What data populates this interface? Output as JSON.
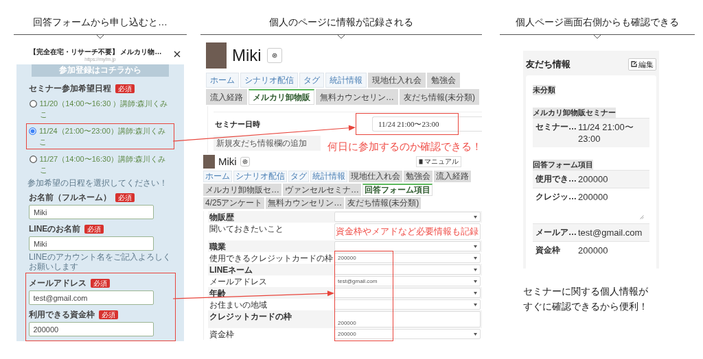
{
  "headings": [
    "回答フォームから申し込むと…",
    "個人のページに情報が記録される",
    "個人ページ画面右側からも確認できる"
  ],
  "form_panel": {
    "title": "【完全在宅・リサーチ不要】 メルカリ物…",
    "url": "https://myfm.jp",
    "banner": "参加登録はコチラから",
    "date_field": {
      "label": "セミナー参加希望日程",
      "badge": "必須",
      "hint": "参加希望の日程を選択してください！",
      "options": [
        {
          "text": "11/20（14:00〜16:30 ）講師:森川くみこ",
          "selected": false
        },
        {
          "text": "11/24（21:00〜23:00）講師:森川くみこ",
          "selected": true
        },
        {
          "text": "11/27（14:00〜16:30）講師:森川くみこ",
          "selected": false
        }
      ]
    },
    "fields": [
      {
        "label": "お名前（フルネーム）",
        "badge": "必須",
        "value": "Miki"
      },
      {
        "label": "LINEのお名前",
        "badge": "必須",
        "value": "Miki",
        "hint": "LINEのアカウント名をご記入よろしくお願いします"
      },
      {
        "label": "メールアドレス",
        "badge": "必須",
        "value": "test@gmail.com"
      },
      {
        "label": "利用できる資金枠",
        "badge": "必須",
        "value": "200000"
      }
    ]
  },
  "profile_top": {
    "name": "Miki",
    "tabs": [
      {
        "label": "ホーム",
        "kind": "main",
        "selected": false
      },
      {
        "label": "シナリオ配信",
        "kind": "main",
        "selected": false
      },
      {
        "label": "タグ",
        "kind": "main",
        "selected": false
      },
      {
        "label": "統計情報",
        "kind": "main",
        "selected": false
      },
      {
        "label": "現地仕入れ会",
        "kind": "custom",
        "selected": false
      },
      {
        "label": "勉強会",
        "kind": "custom",
        "selected": false
      },
      {
        "label": "流入経路",
        "kind": "custom",
        "selected": false
      },
      {
        "label": "メルカリ卸物販",
        "kind": "custom",
        "selected": true
      },
      {
        "label": "無料カウンセリン…",
        "kind": "custom",
        "selected": false
      },
      {
        "label": "友だち情報(未分類)",
        "kind": "custom",
        "selected": false
      }
    ],
    "rows": [
      {
        "label": "セミナー日時",
        "value": "11/24 21:00〜23:00"
      }
    ],
    "add_link": "新規友だち情報欄の追加",
    "annotation": "何日に参加するのか確認できる！"
  },
  "profile_bottom": {
    "name": "Miki",
    "manual_button": "マニュアル",
    "tabs": [
      {
        "label": "ホーム",
        "kind": "main",
        "selected": false
      },
      {
        "label": "シナリオ配信",
        "kind": "main",
        "selected": false
      },
      {
        "label": "タグ",
        "kind": "main",
        "selected": false
      },
      {
        "label": "統計情報",
        "kind": "main",
        "selected": false
      },
      {
        "label": "現地仕入れ会",
        "kind": "custom",
        "selected": false
      },
      {
        "label": "勉強会",
        "kind": "custom",
        "selected": false
      },
      {
        "label": "流入経路",
        "kind": "custom",
        "selected": false
      },
      {
        "label": "メルカリ卸物販セ…",
        "kind": "custom",
        "selected": false
      },
      {
        "label": "ヴァンセルセミナ…",
        "kind": "custom",
        "selected": false
      },
      {
        "label": "回答フォーム項目",
        "kind": "custom",
        "selected": true
      },
      {
        "label": "4/25アンケート",
        "kind": "custom",
        "selected": false
      },
      {
        "label": "無料カウンセリン…",
        "kind": "custom",
        "selected": false
      },
      {
        "label": "友だち情報(未分類)",
        "kind": "custom",
        "selected": false
      }
    ],
    "fields": [
      {
        "label": "物販歴",
        "kind": "select"
      },
      {
        "label": "聞いておきたいこと",
        "kind": "textarea"
      },
      {
        "label": "職業",
        "kind": "select"
      },
      {
        "label": "使用できるクレジットカードの枠",
        "kind": "select",
        "value": "200000"
      },
      {
        "label": "LINEネーム",
        "kind": "select"
      },
      {
        "label": "メールアドレス",
        "kind": "select",
        "value": "test@gmail.com"
      },
      {
        "label": "年齢",
        "kind": "select"
      },
      {
        "label": "お住まいの地域",
        "kind": "select"
      },
      {
        "label": "クレジットカードの枠",
        "kind": "textarea",
        "value": "200000"
      },
      {
        "label": "資金枠",
        "kind": "select",
        "value": "200000"
      }
    ],
    "annotation": "資金枠やメアドなど必要情報も記録"
  },
  "friend_info": {
    "title": "友だち情報",
    "edit_button": "編集",
    "groups": [
      {
        "name": "未分類"
      },
      {
        "name": "メルカリ卸物販セミナー",
        "items": [
          {
            "label": "セミナー…",
            "value": "11/24 21:00〜23:00",
            "kind": "text"
          }
        ]
      },
      {
        "name": "回答フォーム項目",
        "items": [
          {
            "label": "使用でき…",
            "value": "200000",
            "kind": "text"
          },
          {
            "label": "クレジッ…",
            "value": "200000",
            "kind": "textarea"
          },
          {
            "label": "メールア…",
            "value": "test@gmail.com",
            "kind": "text"
          },
          {
            "label": "資金枠",
            "value": "200000",
            "kind": "text"
          }
        ]
      }
    ]
  },
  "caption": [
    "セミナーに関する個人情報が",
    "すぐに確認できるから便利！"
  ]
}
